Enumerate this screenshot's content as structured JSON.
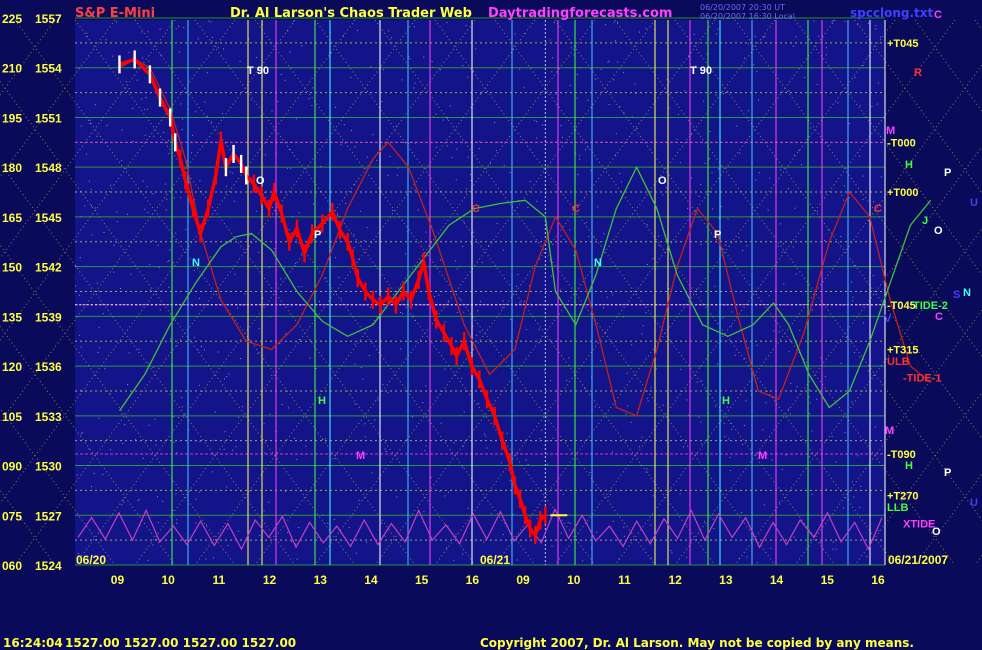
{
  "header": {
    "title": "S&P E-Mini",
    "subtitle": "Dr. Al Larson's Chaos Trader Web",
    "site": "Daytradingforecasts.com",
    "timestamp_1": "06/20/2007 20:30 UT",
    "timestamp_2": "06/20/2007 16:30 Local",
    "file": "spcclong.txt"
  },
  "footer": {
    "time": "16:24:04",
    "ohlc": "1527.00 1527.00 1527.00 1527.00",
    "copyright": "Copyright 2007, Dr. Al Larson. May not be copied by any means."
  },
  "colors": {
    "background": "#0a0a5a",
    "price": "#ff0000",
    "green_cycle": "#40c040",
    "red_cycle": "#c02020",
    "xtide": "#c040c0",
    "grid_yellow": "#e0e040",
    "grid_green": "#30c030",
    "grid_magenta": "#c040c0"
  },
  "chart_data": {
    "type": "line",
    "xlabel": "",
    "ylabel": "",
    "y_left_labels": [
      "225",
      "210",
      "195",
      "180",
      "165",
      "150",
      "135",
      "120",
      "105",
      "090",
      "075",
      "060"
    ],
    "y_price_labels": [
      "1557",
      "1554",
      "1551",
      "1548",
      "1545",
      "1542",
      "1539",
      "1536",
      "1533",
      "1530",
      "1527",
      "1524"
    ],
    "ylim": [
      1524,
      1557
    ],
    "x_hour_labels": [
      "09",
      "10",
      "11",
      "12",
      "13",
      "14",
      "15",
      "16",
      "09",
      "10",
      "11",
      "12",
      "13",
      "14",
      "15",
      "16"
    ],
    "dates": [
      "06/20",
      "06/21",
      "06/21/2007"
    ],
    "right_labels": [
      {
        "text": "+T045",
        "price": 1555.5,
        "color": "#ffff40"
      },
      {
        "text": "-T000",
        "price": 1549.5,
        "color": "#ffff40"
      },
      {
        "text": "+T000",
        "price": 1546.5,
        "color": "#ffff40"
      },
      {
        "text": "-T045",
        "price": 1539.7,
        "color": "#ffff40"
      },
      {
        "text": "+T315",
        "price": 1537.0,
        "color": "#ffff40"
      },
      {
        "text": "ULB",
        "price": 1536.3,
        "color": "#ff3030"
      },
      {
        "text": "-T090",
        "price": 1530.7,
        "color": "#ffff40"
      },
      {
        "text": "+T270",
        "price": 1528.2,
        "color": "#ffff40"
      },
      {
        "text": "LLB",
        "price": 1527.5,
        "color": "#40ff40"
      },
      {
        "text": "-TIDE-1",
        "price": 1535.3,
        "color": "#ff3030"
      },
      {
        "text": "TIDE-2",
        "price": 1539.7,
        "color": "#40ff40"
      },
      {
        "text": "XTIDE",
        "price": 1526.5,
        "color": "#ff40ff"
      }
    ],
    "chart_letters": [
      {
        "text": "C",
        "color": "#ff40ff"
      },
      {
        "text": "R",
        "color": "#ff3030"
      },
      {
        "text": "M",
        "color": "#ff40ff"
      },
      {
        "text": "H",
        "color": "#40ff40"
      },
      {
        "text": "P",
        "color": "#ffffff"
      },
      {
        "text": "U",
        "color": "#4040ff"
      },
      {
        "text": "C",
        "color": "#ff3030"
      },
      {
        "text": "J",
        "color": "#40ff40"
      },
      {
        "text": "O",
        "color": "#ffffff"
      },
      {
        "text": "N",
        "color": "#40ffff"
      },
      {
        "text": "S",
        "color": "#4040ff"
      },
      {
        "text": "V",
        "color": "#4040ff"
      },
      {
        "text": "C",
        "color": "#ff40ff"
      },
      {
        "text": "M",
        "color": "#ff40ff"
      },
      {
        "text": "H",
        "color": "#40ff40"
      },
      {
        "text": "P",
        "color": "#ffffff"
      },
      {
        "text": "U",
        "color": "#4040ff"
      },
      {
        "text": "O",
        "color": "#ffffff"
      },
      {
        "text": "T 90",
        "color": "#ffffff"
      },
      {
        "text": "T 90",
        "color": "#ffffff"
      },
      {
        "text": "O",
        "color": "#ffffff"
      },
      {
        "text": "O",
        "color": "#ffffff"
      },
      {
        "text": "N",
        "color": "#40ffff"
      },
      {
        "text": "N",
        "color": "#40ffff"
      },
      {
        "text": "P",
        "color": "#ffffff"
      },
      {
        "text": "P",
        "color": "#ffffff"
      },
      {
        "text": "C",
        "color": "#ff3030"
      },
      {
        "text": "C",
        "color": "#ff3030"
      },
      {
        "text": "M",
        "color": "#ff40ff"
      },
      {
        "text": "M",
        "color": "#ff40ff"
      },
      {
        "text": "H",
        "color": "#40ff40"
      },
      {
        "text": "H",
        "color": "#40ff40"
      }
    ],
    "price_series": [
      [
        0.0,
        1554.2
      ],
      [
        0.3,
        1554.5
      ],
      [
        0.6,
        1553.6
      ],
      [
        0.8,
        1552.2
      ],
      [
        1.0,
        1551.0
      ],
      [
        1.1,
        1549.5
      ],
      [
        1.2,
        1548.5
      ],
      [
        1.3,
        1547.2
      ],
      [
        1.45,
        1545.5
      ],
      [
        1.6,
        1544.0
      ],
      [
        1.75,
        1545.5
      ],
      [
        1.9,
        1547.5
      ],
      [
        2.0,
        1549.6
      ],
      [
        2.1,
        1548.0
      ],
      [
        2.25,
        1548.8
      ],
      [
        2.4,
        1548.2
      ],
      [
        2.5,
        1547.5
      ],
      [
        2.65,
        1547.0
      ],
      [
        2.8,
        1546.3
      ],
      [
        2.95,
        1545.5
      ],
      [
        3.05,
        1546.5
      ],
      [
        3.2,
        1545.2
      ],
      [
        3.35,
        1543.5
      ],
      [
        3.5,
        1544.3
      ],
      [
        3.65,
        1542.8
      ],
      [
        3.8,
        1544.0
      ],
      [
        4.0,
        1544.6
      ],
      [
        4.2,
        1545.3
      ],
      [
        4.35,
        1544.2
      ],
      [
        4.5,
        1543.5
      ],
      [
        4.6,
        1542.5
      ],
      [
        4.7,
        1541.3
      ],
      [
        4.85,
        1540.5
      ],
      [
        5.0,
        1540.0
      ],
      [
        5.15,
        1539.7
      ],
      [
        5.3,
        1540.2
      ],
      [
        5.45,
        1539.7
      ],
      [
        5.6,
        1540.5
      ],
      [
        5.75,
        1540.0
      ],
      [
        5.9,
        1541.2
      ],
      [
        6.0,
        1542.3
      ],
      [
        6.1,
        1540.5
      ],
      [
        6.25,
        1538.8
      ],
      [
        6.4,
        1538.0
      ],
      [
        6.55,
        1537.2
      ],
      [
        6.65,
        1536.6
      ],
      [
        6.8,
        1537.5
      ],
      [
        6.95,
        1536.0
      ],
      [
        7.1,
        1535.2
      ],
      [
        7.25,
        1534.0
      ],
      [
        7.4,
        1533.0
      ],
      [
        7.55,
        1531.5
      ],
      [
        7.7,
        1530.2
      ],
      [
        7.8,
        1528.8
      ],
      [
        7.9,
        1528.0
      ],
      [
        8.0,
        1527.0
      ],
      [
        8.1,
        1526.2
      ],
      [
        8.2,
        1525.8
      ],
      [
        8.3,
        1526.7
      ],
      [
        8.4,
        1527.0
      ]
    ],
    "green_cycle": [
      [
        0.0,
        1533.3
      ],
      [
        0.5,
        1535.5
      ],
      [
        1.0,
        1538.5
      ],
      [
        1.5,
        1541.0
      ],
      [
        2.0,
        1543.2
      ],
      [
        2.3,
        1543.8
      ],
      [
        2.6,
        1544.0
      ],
      [
        3.0,
        1543.0
      ],
      [
        3.5,
        1540.5
      ],
      [
        4.0,
        1538.7
      ],
      [
        4.5,
        1537.8
      ],
      [
        5.0,
        1538.5
      ],
      [
        5.5,
        1540.5
      ],
      [
        6.0,
        1542.5
      ],
      [
        6.5,
        1544.5
      ],
      [
        7.0,
        1545.5
      ],
      [
        7.5,
        1545.8
      ],
      [
        8.0,
        1546.0
      ],
      [
        8.4,
        1545.0
      ],
      [
        8.6,
        1540.5
      ],
      [
        9.0,
        1538.5
      ],
      [
        9.4,
        1541.5
      ],
      [
        9.8,
        1545.5
      ],
      [
        10.2,
        1548.0
      ],
      [
        10.6,
        1545.5
      ],
      [
        11.0,
        1541.5
      ],
      [
        11.5,
        1538.5
      ],
      [
        12.0,
        1537.8
      ],
      [
        12.5,
        1538.5
      ],
      [
        12.9,
        1539.8
      ],
      [
        13.2,
        1538.5
      ],
      [
        13.6,
        1535.5
      ],
      [
        14.0,
        1533.5
      ],
      [
        14.4,
        1534.5
      ],
      [
        14.8,
        1537.5
      ],
      [
        15.2,
        1541.0
      ],
      [
        15.6,
        1544.5
      ],
      [
        16.0,
        1546.0
      ]
    ],
    "red_cycle": [
      [
        0.0,
        1554.0
      ],
      [
        0.3,
        1554.5
      ],
      [
        0.6,
        1554.0
      ],
      [
        1.0,
        1551.5
      ],
      [
        1.3,
        1548.5
      ],
      [
        1.6,
        1544.0
      ],
      [
        2.0,
        1540.0
      ],
      [
        2.5,
        1537.5
      ],
      [
        3.0,
        1537.0
      ],
      [
        3.5,
        1538.5
      ],
      [
        4.0,
        1541.5
      ],
      [
        4.5,
        1545.5
      ],
      [
        5.0,
        1548.5
      ],
      [
        5.3,
        1549.5
      ],
      [
        5.7,
        1548.0
      ],
      [
        6.2,
        1544.0
      ],
      [
        6.8,
        1538.5
      ],
      [
        7.3,
        1535.5
      ],
      [
        7.8,
        1537.0
      ],
      [
        8.2,
        1542.0
      ],
      [
        8.6,
        1545.0
      ],
      [
        9.0,
        1543.0
      ],
      [
        9.4,
        1538.5
      ],
      [
        9.8,
        1533.5
      ],
      [
        10.2,
        1533.0
      ],
      [
        10.6,
        1537.0
      ],
      [
        11.0,
        1542.0
      ],
      [
        11.4,
        1545.5
      ],
      [
        11.8,
        1544.0
      ],
      [
        12.2,
        1539.0
      ],
      [
        12.6,
        1534.5
      ],
      [
        13.0,
        1534.0
      ],
      [
        13.5,
        1538.0
      ],
      [
        14.0,
        1543.5
      ],
      [
        14.4,
        1546.5
      ],
      [
        14.8,
        1545.0
      ],
      [
        15.2,
        1540.0
      ],
      [
        15.6,
        1536.0
      ],
      [
        16.0,
        1535.0
      ]
    ],
    "xtide_amp": [
      0.6,
      1.2,
      0.8,
      1.6,
      0.9,
      1.8,
      1.1,
      0.5,
      1.4,
      0.9,
      1.5,
      0.7,
      1.9,
      1.0,
      0.6,
      1.3,
      1.7,
      0.8,
      1.2,
      0.5,
      1.6,
      1.0,
      1.4,
      0.7,
      1.1,
      1.8,
      0.9,
      0.6,
      1.3,
      1.5,
      0.8,
      1.7,
      1.0,
      0.6,
      1.2,
      1.9,
      0.7,
      1.4,
      1.0,
      0.5,
      1.6,
      0.9,
      1.3,
      1.1,
      0.7,
      1.8,
      0.9,
      1.5,
      0.6,
      1.2,
      1.7,
      0.8,
      1.4,
      1.0,
      0.6,
      1.6,
      1.1,
      0.8,
      1.9,
      1.2
    ]
  }
}
